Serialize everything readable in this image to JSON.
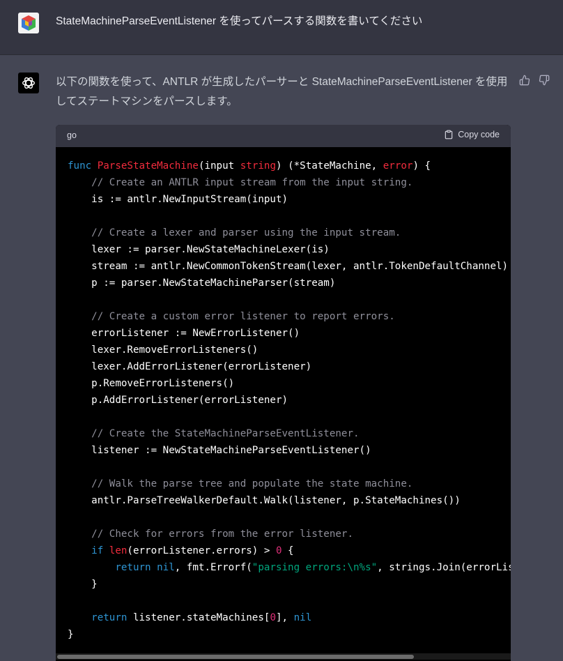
{
  "user_message": {
    "text": "StateMachineParseEventListener を使ってパースする関数を書いてください"
  },
  "assistant_message": {
    "intro": "以下の関数を使って、ANTLR が生成したパーサーと StateMachineParseEventListener を使用してステートマシンをパースします。",
    "code_block": {
      "language": "go",
      "copy_label": "Copy code",
      "lines": [
        [
          [
            "kw",
            "func "
          ],
          [
            "fn",
            "ParseStateMachine"
          ],
          [
            "",
            "(input "
          ],
          [
            "fn",
            "string"
          ],
          [
            "",
            ") (*StateMachine, "
          ],
          [
            "fn",
            "error"
          ],
          [
            "",
            ") {"
          ]
        ],
        [
          [
            "cm",
            "    // Create an ANTLR input stream from the input string."
          ]
        ],
        [
          [
            "",
            "    is := antlr.NewInputStream(input)"
          ]
        ],
        [
          [
            "",
            ""
          ]
        ],
        [
          [
            "cm",
            "    // Create a lexer and parser using the input stream."
          ]
        ],
        [
          [
            "",
            "    lexer := parser.NewStateMachineLexer(is)"
          ]
        ],
        [
          [
            "",
            "    stream := antlr.NewCommonTokenStream(lexer, antlr.TokenDefaultChannel)"
          ]
        ],
        [
          [
            "",
            "    p := parser.NewStateMachineParser(stream)"
          ]
        ],
        [
          [
            "",
            ""
          ]
        ],
        [
          [
            "cm",
            "    // Create a custom error listener to report errors."
          ]
        ],
        [
          [
            "",
            "    errorListener := NewErrorListener()"
          ]
        ],
        [
          [
            "",
            "    lexer.RemoveErrorListeners()"
          ]
        ],
        [
          [
            "",
            "    lexer.AddErrorListener(errorListener)"
          ]
        ],
        [
          [
            "",
            "    p.RemoveErrorListeners()"
          ]
        ],
        [
          [
            "",
            "    p.AddErrorListener(errorListener)"
          ]
        ],
        [
          [
            "",
            ""
          ]
        ],
        [
          [
            "cm",
            "    // Create the StateMachineParseEventListener."
          ]
        ],
        [
          [
            "",
            "    listener := NewStateMachineParseEventListener()"
          ]
        ],
        [
          [
            "",
            ""
          ]
        ],
        [
          [
            "cm",
            "    // Walk the parse tree and populate the state machine."
          ]
        ],
        [
          [
            "",
            "    antlr.ParseTreeWalkerDefault.Walk(listener, p.StateMachines())"
          ]
        ],
        [
          [
            "",
            ""
          ]
        ],
        [
          [
            "cm",
            "    // Check for errors from the error listener."
          ]
        ],
        [
          [
            "kw",
            "    if "
          ],
          [
            "fn",
            "len"
          ],
          [
            "",
            "(errorListener.errors) > "
          ],
          [
            "num",
            "0"
          ],
          [
            "",
            " {"
          ]
        ],
        [
          [
            "kw",
            "        return "
          ],
          [
            "kw",
            "nil"
          ],
          [
            "",
            ", fmt.Errorf("
          ],
          [
            "str",
            "\"parsing errors:\\n%s\""
          ],
          [
            "",
            ", strings.Join(errorListener.errors, \"\\n\"))"
          ]
        ],
        [
          [
            "",
            "    }"
          ]
        ],
        [
          [
            "",
            ""
          ]
        ],
        [
          [
            "kw",
            "    return "
          ],
          [
            "",
            "listener.stateMachines["
          ],
          [
            "num",
            "0"
          ],
          [
            "",
            "], "
          ],
          [
            "kw",
            "nil"
          ]
        ],
        [
          [
            "",
            "}"
          ]
        ]
      ]
    }
  },
  "colors": {
    "keyword": "#2e95d3",
    "function": "#f22c3d",
    "comment": "#8f8f9a",
    "string": "#00a67d",
    "number": "#df3079"
  }
}
